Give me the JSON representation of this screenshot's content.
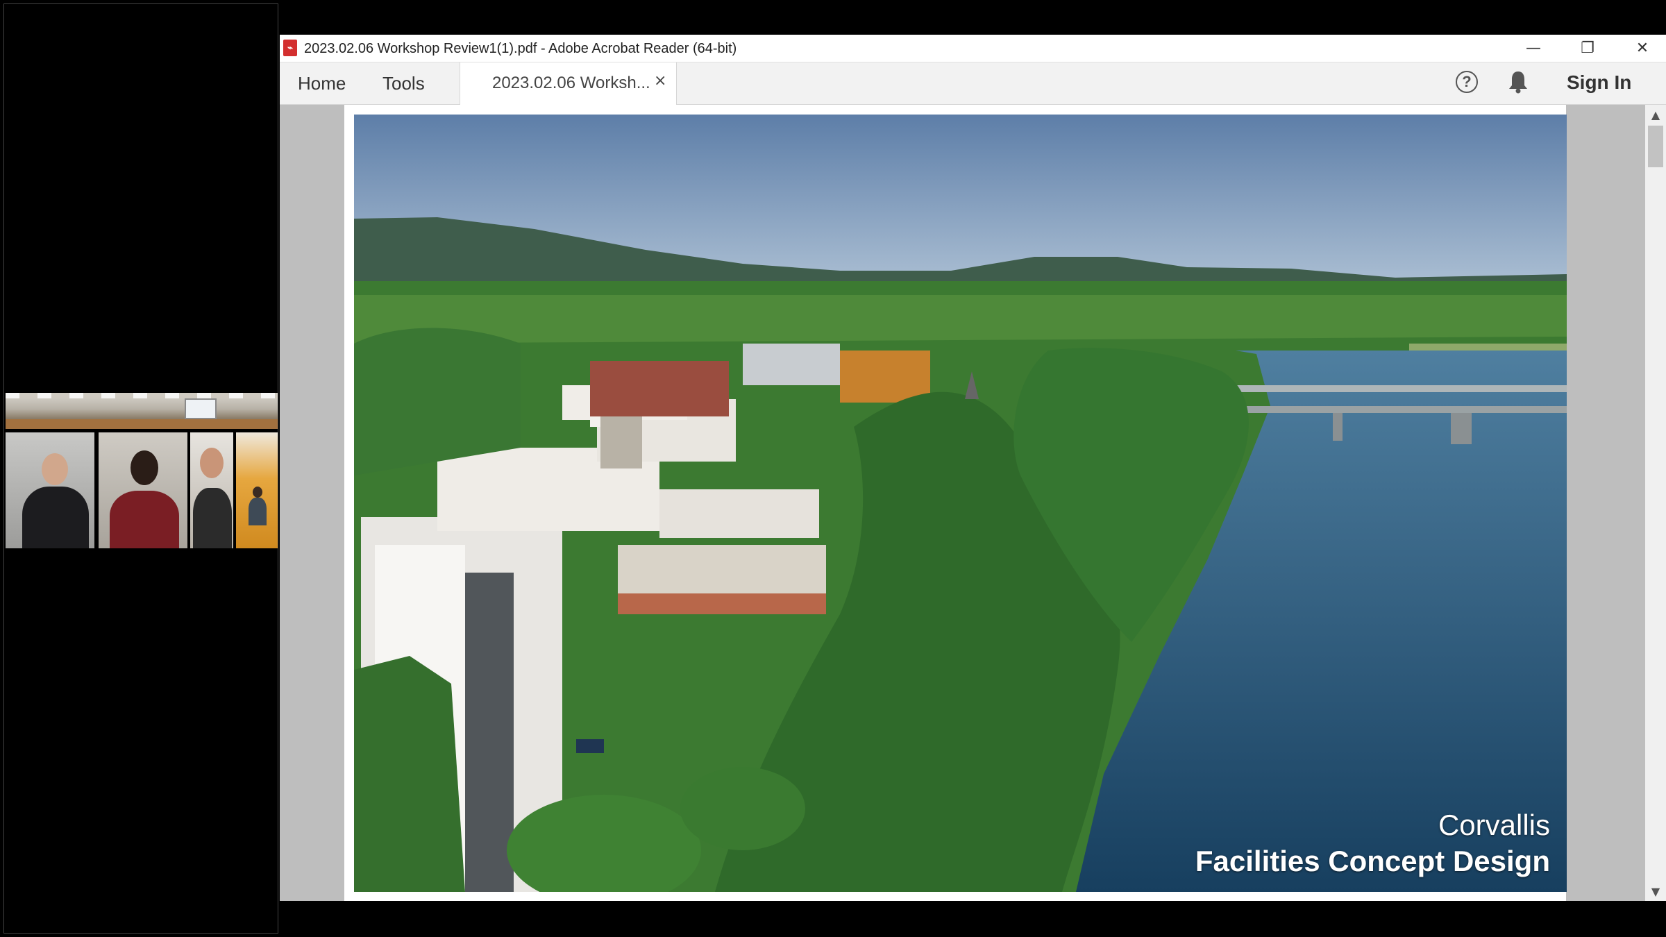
{
  "conference": {
    "participants": [
      {
        "name_tag": ""
      },
      {
        "name_tag": ""
      },
      {
        "name_tag": ""
      },
      {
        "name_tag": ""
      }
    ]
  },
  "window": {
    "title": "2023.02.06 Workshop Review1(1).pdf - Adobe Acrobat Reader (64-bit)",
    "minimize_glyph": "—",
    "restore_glyph": "❐",
    "close_glyph": "✕"
  },
  "tabs": {
    "home": "Home",
    "tools": "Tools",
    "document_tab": "2023.02.06 Worksh...",
    "document_close": "×"
  },
  "toolbar": {
    "help_glyph": "?",
    "sign_in": "Sign In"
  },
  "slide": {
    "line1": "Corvallis",
    "line2": "Facilities Concept Design"
  },
  "scroll": {
    "up_glyph": "▲",
    "down_glyph": "▼"
  },
  "colors": {
    "sky": "#6b8bb3",
    "river": "#21587e",
    "forest": "#2f6a2a",
    "acrobat_red": "#d32f2f"
  }
}
